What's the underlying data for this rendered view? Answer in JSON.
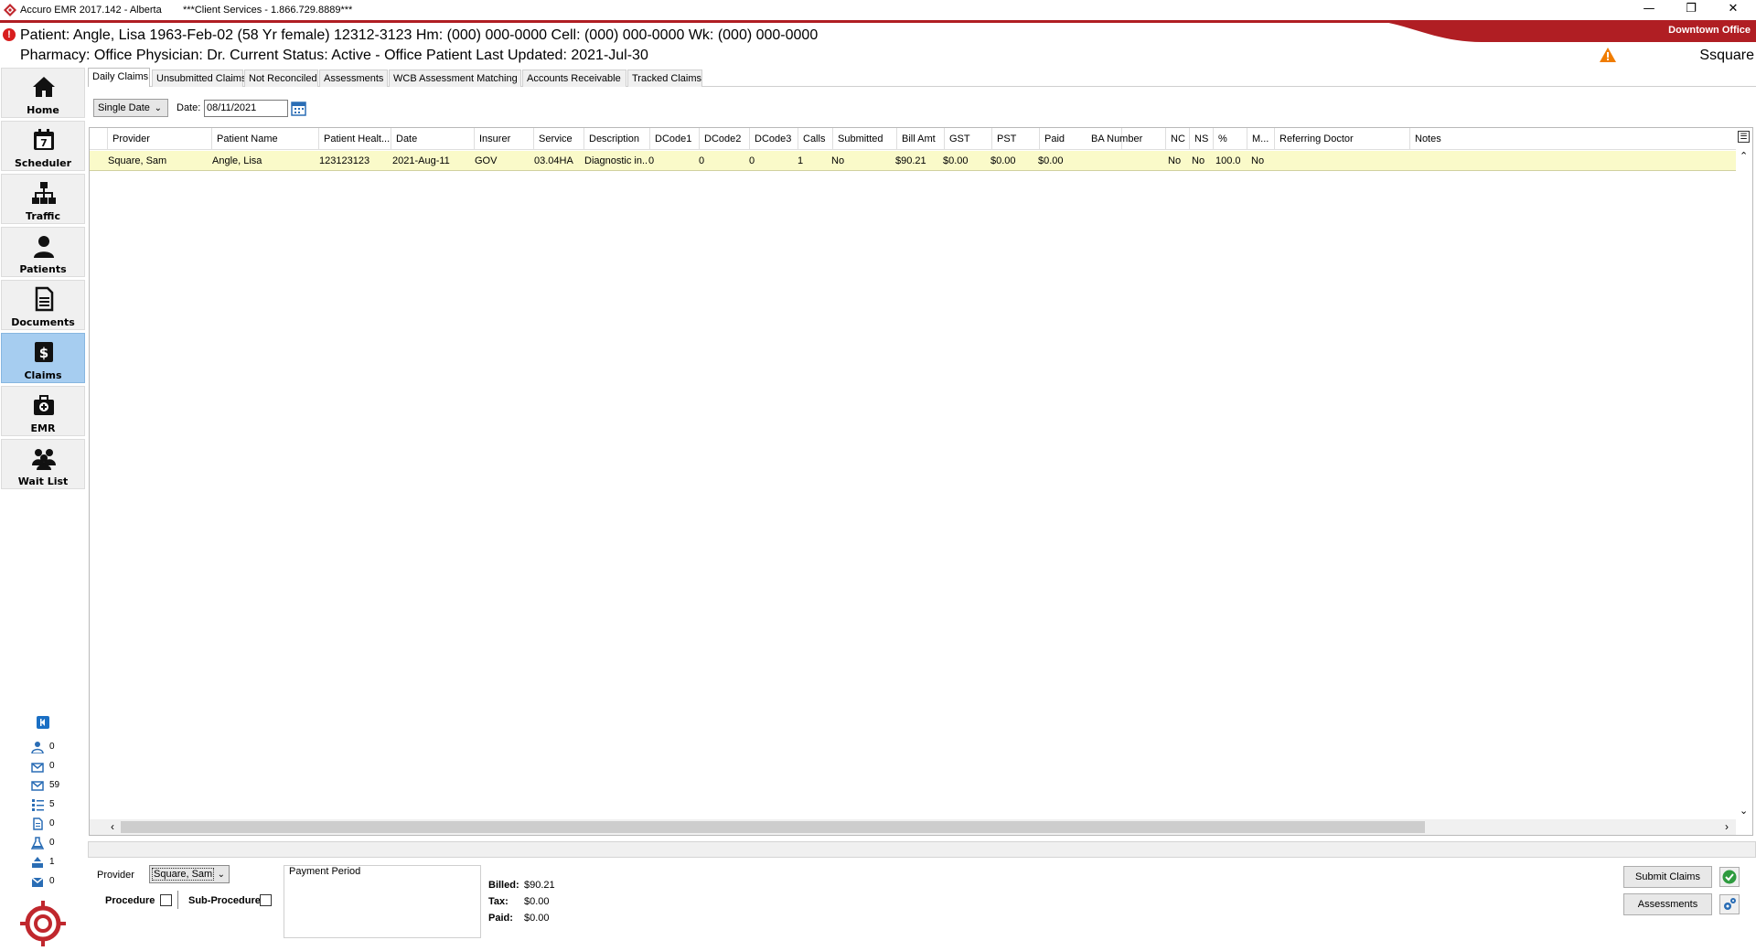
{
  "window": {
    "title": "Accuro EMR 2017.142 - Alberta",
    "client_services": "***Client Services - 1.866.729.8889***",
    "office": "Downtown Office",
    "controls": [
      "—",
      "❐",
      "✕"
    ]
  },
  "patient_header": {
    "line1": "Patient: Angle, Lisa 1963-Feb-02 (58 Yr female) 12312-3123 Hm: (000) 000-0000 Cell: (000) 000-0000 Wk: (000) 000-0000",
    "line2": "Pharmacy:  Office Physician: Dr.  Current Status: Active - Office Patient Last Updated: 2021-Jul-30",
    "alert_icon": "!",
    "user": "Ssquare"
  },
  "sidebar": {
    "items": [
      {
        "label": "Home",
        "icon": "home-icon"
      },
      {
        "label": "Scheduler",
        "icon": "calendar-icon",
        "badge": "7"
      },
      {
        "label": "Traffic",
        "icon": "traffic-icon"
      },
      {
        "label": "Patients",
        "icon": "person-icon"
      },
      {
        "label": "Documents",
        "icon": "document-icon"
      },
      {
        "label": "Claims",
        "icon": "dollar-icon",
        "badge": "$"
      },
      {
        "label": "EMR",
        "icon": "medical-bag-icon"
      },
      {
        "label": "Wait List",
        "icon": "group-icon"
      }
    ],
    "active": "Claims",
    "counters": [
      {
        "icon": "person-key-icon",
        "value": "0"
      },
      {
        "icon": "inbox-down-icon",
        "value": "0"
      },
      {
        "icon": "mail-icon",
        "value": "59"
      },
      {
        "icon": "list-icon",
        "value": "5"
      },
      {
        "icon": "doc-icon",
        "value": "0"
      },
      {
        "icon": "flask-icon",
        "value": "0"
      },
      {
        "icon": "tray-up-icon",
        "value": "1"
      },
      {
        "icon": "tray-mail-icon",
        "value": "0"
      }
    ]
  },
  "tabs": [
    "Daily Claims",
    "Unsubmitted Claims",
    "Not Reconciled",
    "Assessments",
    "WCB Assessment Matching",
    "Accounts Receivable",
    "Tracked Claims"
  ],
  "active_tab": "Daily Claims",
  "filter": {
    "mode": "Single Date",
    "date_label": "Date:",
    "date_value": "08/11/2021"
  },
  "grid": {
    "columns": [
      "Provider",
      "Patient Name",
      "Patient Healt...",
      "Date",
      "Insurer",
      "Service",
      "Description",
      "DCode1",
      "DCode2",
      "DCode3",
      "Calls",
      "Submitted",
      "Bill Amt",
      "GST",
      "PST",
      "Paid",
      "BA Number",
      "NC",
      "NS",
      "%",
      "M...",
      "Referring Doctor",
      "Notes"
    ],
    "rows": [
      [
        "Square, Sam",
        "Angle, Lisa",
        "123123123",
        "2021-Aug-11",
        "GOV",
        "03.04HA",
        "Diagnostic in...",
        "0",
        "0",
        "0",
        "1",
        "No",
        "$90.21",
        "$0.00",
        "$0.00",
        "$0.00",
        "",
        "No",
        "No",
        "100.0",
        "No",
        "",
        ""
      ]
    ]
  },
  "bottom": {
    "provider_label": "Provider",
    "provider_value": "Square, Sam",
    "procedure_label": "Procedure",
    "subprocedure_label": "Sub-Procedure",
    "payment_period_label": "Payment Period",
    "billed_label": "Billed:",
    "billed_value": "$90.21",
    "tax_label": "Tax:",
    "tax_value": "$0.00",
    "paid_label": "Paid:",
    "paid_value": "$0.00",
    "submit_button": "Submit Claims",
    "assessments_button": "Assessments"
  },
  "colors": {
    "brand_red": "#b01e23",
    "active_nav": "#a6cdf0",
    "row_highlight": "#fafac9",
    "warning": "#f07c00"
  }
}
